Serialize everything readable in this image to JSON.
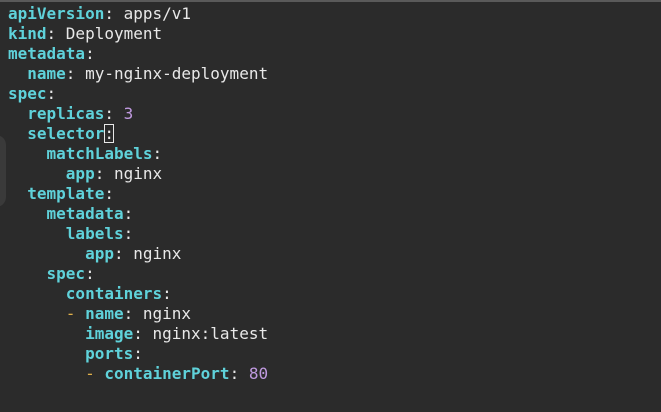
{
  "editor": {
    "lines": [
      {
        "indent": "",
        "dash": "",
        "key": "apiVersion",
        "sep": ": ",
        "value": "apps/v1",
        "value_type": "string"
      },
      {
        "indent": "",
        "dash": "",
        "key": "kind",
        "sep": ": ",
        "value": "Deployment",
        "value_type": "string"
      },
      {
        "indent": "",
        "dash": "",
        "key": "metadata",
        "sep": ":",
        "value": "",
        "value_type": "string"
      },
      {
        "indent": "  ",
        "dash": "",
        "key": "name",
        "sep": ": ",
        "value": "my-nginx-deployment",
        "value_type": "string"
      },
      {
        "indent": "",
        "dash": "",
        "key": "spec",
        "sep": ":",
        "value": "",
        "value_type": "string"
      },
      {
        "indent": "  ",
        "dash": "",
        "key": "replicas",
        "sep": ": ",
        "value": "3",
        "value_type": "number"
      },
      {
        "indent": "  ",
        "dash": "",
        "key": "selector",
        "sep": ":",
        "value": "",
        "value_type": "string",
        "cursor": true
      },
      {
        "indent": "    ",
        "dash": "",
        "key": "matchLabels",
        "sep": ":",
        "value": "",
        "value_type": "string"
      },
      {
        "indent": "      ",
        "dash": "",
        "key": "app",
        "sep": ": ",
        "value": "nginx",
        "value_type": "string"
      },
      {
        "indent": "  ",
        "dash": "",
        "key": "template",
        "sep": ":",
        "value": "",
        "value_type": "string"
      },
      {
        "indent": "    ",
        "dash": "",
        "key": "metadata",
        "sep": ":",
        "value": "",
        "value_type": "string"
      },
      {
        "indent": "      ",
        "dash": "",
        "key": "labels",
        "sep": ":",
        "value": "",
        "value_type": "string"
      },
      {
        "indent": "        ",
        "dash": "",
        "key": "app",
        "sep": ": ",
        "value": "nginx",
        "value_type": "string"
      },
      {
        "indent": "    ",
        "dash": "",
        "key": "spec",
        "sep": ":",
        "value": "",
        "value_type": "string"
      },
      {
        "indent": "      ",
        "dash": "",
        "key": "containers",
        "sep": ":",
        "value": "",
        "value_type": "string"
      },
      {
        "indent": "      ",
        "dash": "- ",
        "key": "name",
        "sep": ": ",
        "value": "nginx",
        "value_type": "string"
      },
      {
        "indent": "        ",
        "dash": "",
        "key": "image",
        "sep": ": ",
        "value": "nginx:latest",
        "value_type": "string"
      },
      {
        "indent": "        ",
        "dash": "",
        "key": "ports",
        "sep": ":",
        "value": "",
        "value_type": "string"
      },
      {
        "indent": "        ",
        "dash": "- ",
        "key": "containerPort",
        "sep": ": ",
        "value": "80",
        "value_type": "number"
      }
    ]
  },
  "colors": {
    "background": "#2b2b2b",
    "key": "#5fd2da",
    "text": "#e8e8e8",
    "number": "#c09ae0",
    "dash": "#e0b04a"
  }
}
